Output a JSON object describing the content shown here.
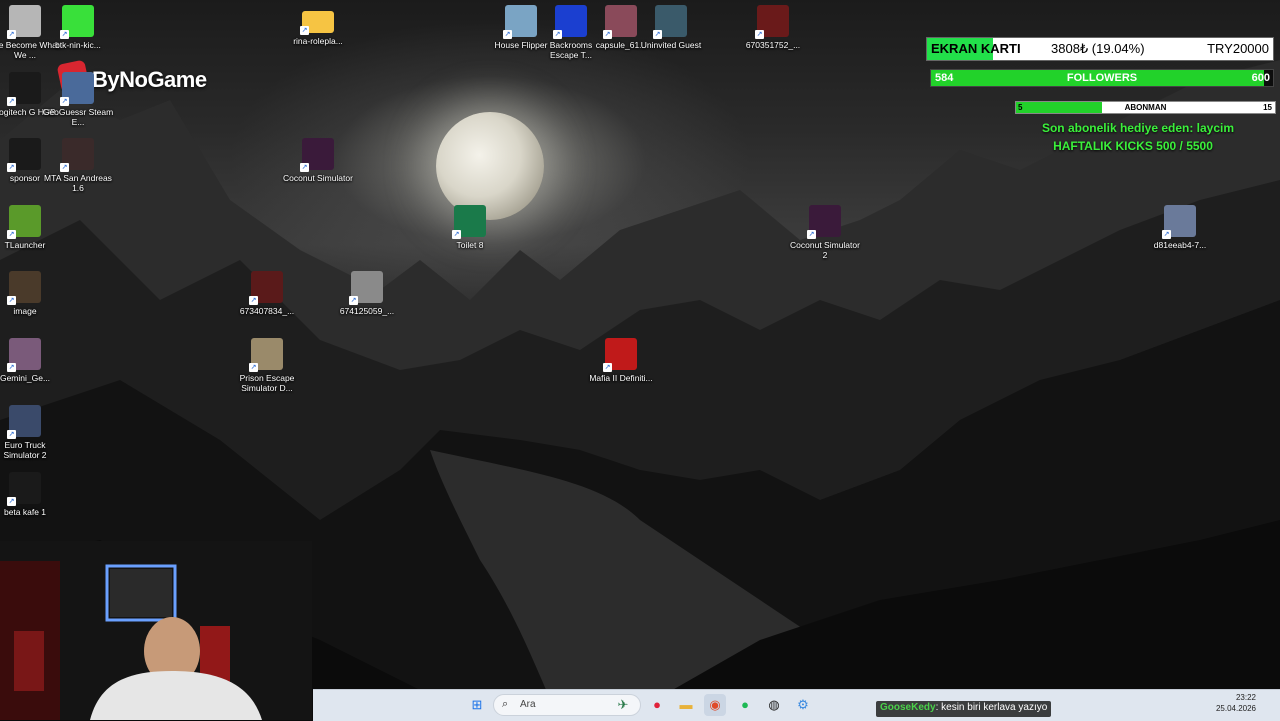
{
  "desktop_icons": [
    {
      "label": "We Become What We ...",
      "icon": "game-icon",
      "color": "#b6b6b6"
    },
    {
      "label": "btk-nin-kic...",
      "icon": "kick-icon",
      "color": "#39e03a"
    },
    {
      "label": "rina-rolepla...",
      "icon": "folder-icon",
      "color": "#f6c443"
    },
    {
      "label": "House Flipper",
      "icon": "game-icon",
      "color": "#7aa4c4"
    },
    {
      "label": "Backrooms Escape T...",
      "icon": "game-icon",
      "color": "#1b3fd0"
    },
    {
      "label": "capsule_61...",
      "icon": "image-icon",
      "color": "#8a4a5a"
    },
    {
      "label": "Uninvited Guest",
      "icon": "game-icon",
      "color": "#3a5a6a"
    },
    {
      "label": "670351752_...",
      "icon": "image-icon",
      "color": "#6a1a1a"
    },
    {
      "label": "Logitech G HUB",
      "icon": "logitech-icon",
      "color": "#1a1a1a"
    },
    {
      "label": "GeoGuessr Steam E...",
      "icon": "game-icon",
      "color": "#4a6a9a"
    },
    {
      "label": "sponsor",
      "icon": "sponsor-icon",
      "color": "#1a1a1a"
    },
    {
      "label": "MTA San Andreas 1.6",
      "icon": "game-icon",
      "color": "#3a2a2a"
    },
    {
      "label": "Coconut Simulator",
      "icon": "game-icon",
      "color": "#3a1a3a"
    },
    {
      "label": "Toilet 8",
      "icon": "game-icon",
      "color": "#1a7a4a"
    },
    {
      "label": "Coconut Simulator 2",
      "icon": "game-icon",
      "color": "#3a1a3a"
    },
    {
      "label": "d81eeab4-7...",
      "icon": "image-icon",
      "color": "#6a7a9a"
    },
    {
      "label": "TLauncher",
      "icon": "minecraft-icon",
      "color": "#5a9a2a"
    },
    {
      "label": "673407834_...",
      "icon": "image-icon",
      "color": "#5a1a1a"
    },
    {
      "label": "674125059_...",
      "icon": "image-icon",
      "color": "#8a8a8a"
    },
    {
      "label": "image",
      "icon": "image-icon",
      "color": "#4a3a2a"
    },
    {
      "label": "Prison Escape Simulator D...",
      "icon": "game-icon",
      "color": "#9a8a6a"
    },
    {
      "label": "Mafia II Definiti...",
      "icon": "game-icon",
      "color": "#c01a1a"
    },
    {
      "label": "Gemini_Ge...",
      "icon": "image-icon",
      "color": "#7a5a7a"
    },
    {
      "label": "Euro Truck Simulator 2",
      "icon": "game-icon",
      "color": "#3a4a6a"
    },
    {
      "label": "beta kafe 1",
      "icon": "file-icon",
      "color": "#1a1a1a"
    }
  ],
  "overlay": {
    "brand": "ByNoGame",
    "gpu": {
      "title": "EKRAN KARTI",
      "amount": "3808₺ (19.04%)",
      "goal": "TRY20000",
      "progress": 0.1904
    },
    "followers": {
      "label": "FOLLOWERS",
      "current": "584",
      "goal": "600",
      "progress": 0.973
    },
    "subs": {
      "label": "ABONMAN",
      "current": "5",
      "goal": "15",
      "progress": 0.333
    },
    "gift_text": "Son abonelik hediye eden: laycim",
    "kicks_text": "HAFTALIK KICKS 500 / 5500"
  },
  "taskbar": {
    "search_placeholder": "Ara",
    "apps": [
      "windows-start-icon",
      "search-icon",
      "steam-icon",
      "record-icon",
      "file-explorer-icon",
      "chrome-icon",
      "spotify-icon",
      "obs-icon",
      "settings-icon"
    ],
    "chat": {
      "user": "GooseKedy",
      "message": ": kesin biri kerlava yazıyo"
    },
    "time": "23:22",
    "date": "25.04.2026"
  }
}
